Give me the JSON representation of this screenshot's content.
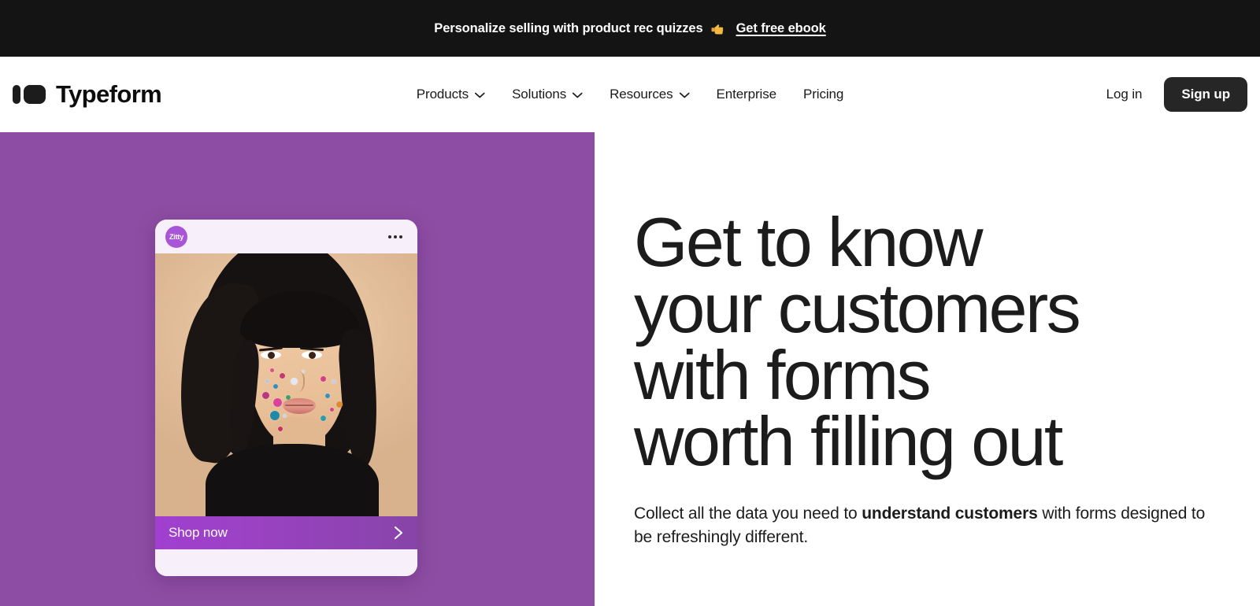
{
  "promo": {
    "text": "Personalize selling with product rec quizzes",
    "emoji_name": "pointing-right-hand",
    "link_label": "Get free ebook"
  },
  "header": {
    "brand_name": "Typeform",
    "nav": [
      {
        "label": "Products",
        "has_dropdown": true
      },
      {
        "label": "Solutions",
        "has_dropdown": true
      },
      {
        "label": "Resources",
        "has_dropdown": true
      },
      {
        "label": "Enterprise",
        "has_dropdown": false
      },
      {
        "label": "Pricing",
        "has_dropdown": false
      }
    ],
    "login_label": "Log in",
    "signup_label": "Sign up"
  },
  "hero": {
    "headline_lines": [
      "Get to know",
      "your customers",
      "with forms",
      "worth filling out"
    ],
    "subhead": {
      "before": "Collect all the data you need to ",
      "bold": "understand customers",
      "after": " with forms designed to be refreshingly different."
    },
    "card": {
      "avatar_label": "Zitty",
      "menu_icon": "more-horizontal-icon",
      "cta_label": "Shop now",
      "cta_arrow_icon": "chevron-right-icon"
    }
  },
  "colors": {
    "banner_bg": "#141414",
    "panel_purple": "#8D4DA4",
    "avatar_purple": "#A855D8",
    "card_bg": "#F7EFFA",
    "shop_bar_start": "#A03FD0",
    "shop_bar_end": "#8744A8",
    "dark_text": "#1c1c1c",
    "signup_bg": "#262627",
    "emoji_gold": "#F5B942"
  }
}
